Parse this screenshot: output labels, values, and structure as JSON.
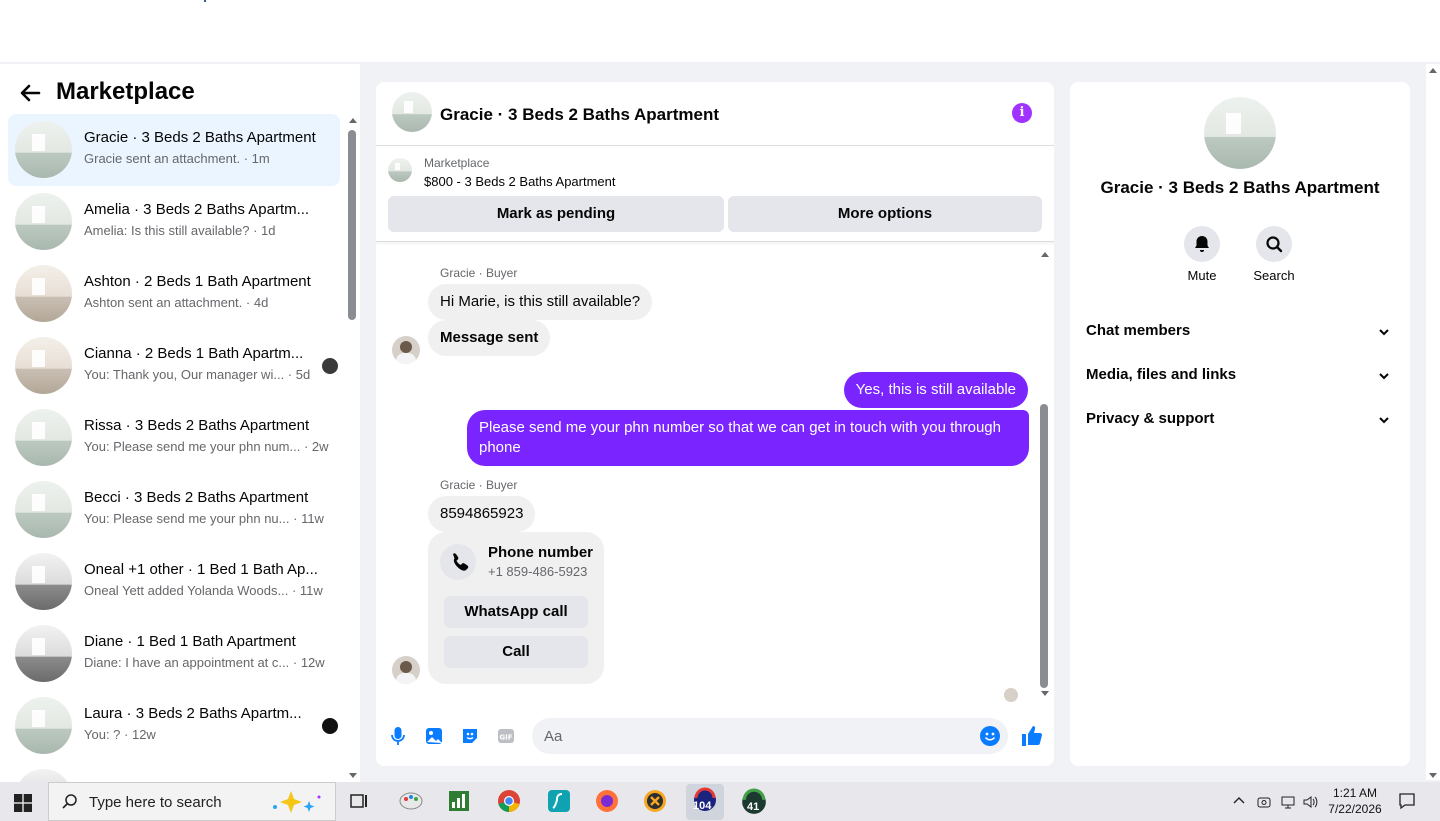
{
  "marketplace": {
    "title": "Marketplace",
    "conversations": [
      {
        "name": "Gracie · 3 Beds 2 Baths Apartment",
        "preview": "Gracie sent an attachment.",
        "time": "1m",
        "active": true
      },
      {
        "name": "Amelia · 3 Beds 2 Baths Apartm...",
        "preview": "Amelia: Is this still available?",
        "time": "1d"
      },
      {
        "name": "Ashton · 2 Beds 1 Bath Apartment",
        "preview": "Ashton sent an attachment.",
        "time": "4d"
      },
      {
        "name": "Cianna · 2 Beds 1 Bath Apartm...",
        "preview": "You: Thank you, Our manager wi...",
        "time": "5d"
      },
      {
        "name": "Rissa · 3 Beds 2 Baths Apartment",
        "preview": "You: Please send me your phn num...",
        "time": "2w"
      },
      {
        "name": "Becci · 3 Beds 2 Baths Apartment",
        "preview": "You: Please send me your phn nu...",
        "time": "11w"
      },
      {
        "name": "Oneal +1 other · 1 Bed 1 Bath Ap...",
        "preview": "Oneal Yett added Yolanda Woods...",
        "time": "11w"
      },
      {
        "name": "Diane · 1 Bed 1 Bath Apartment",
        "preview": "Diane: I have an appointment at c...",
        "time": "12w"
      },
      {
        "name": "Laura · 3 Beds 2 Baths Apartm...",
        "preview": "You: ?",
        "time": "12w"
      }
    ]
  },
  "chat": {
    "title": "Gracie · 3 Beds 2 Baths Apartment",
    "listing_label": "Marketplace",
    "listing": "$800 - 3 Beds 2 Baths Apartment",
    "btn_pending": "Mark as pending",
    "btn_more": "More options",
    "sender_label": "Gracie · Buyer",
    "msg1": "Hi Marie, is this still available?",
    "msg2": "Message sent",
    "msg3": "Yes, this is still  available",
    "msg4": "Please send me your phn number so that we can get in touch with you through phone",
    "msg5": "8594865923",
    "phone_title": "Phone number",
    "phone_value": "+1 859-486-5923",
    "whatsapp": "WhatsApp call",
    "call": "Call",
    "input_placeholder": "Aa"
  },
  "panel": {
    "title": "Gracie · 3 Beds 2 Baths Apartment",
    "mute": "Mute",
    "search": "Search",
    "sections": [
      "Chat members",
      "Media, files and links",
      "Privacy & support"
    ]
  },
  "taskbar": {
    "search_placeholder": "Type here to search",
    "badge1": "104",
    "badge2": "41",
    "time": "1:21 AM",
    "date": "7/22/2026"
  },
  "colors": {
    "accent": "#7a24ff",
    "info": "#a033ff",
    "composer_icons": "#0a7cff"
  }
}
